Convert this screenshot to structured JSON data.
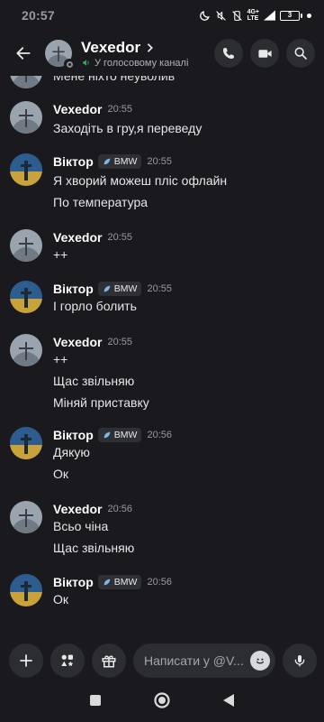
{
  "status": {
    "time": "20:57",
    "network": "4G+",
    "battery": "3"
  },
  "header": {
    "title": "Vexedor",
    "subtitle": "У голосовому каналі"
  },
  "partial_message": "Мене ніхто неуволив",
  "role_tag": "BMW",
  "groups": [
    {
      "author": "Vexedor",
      "tag": false,
      "time": "20:55",
      "lines": [
        "Заходіть в гру,я переведу"
      ]
    },
    {
      "author": "Віктор",
      "tag": true,
      "time": "20:55",
      "lines": [
        "Я хворий можеш пліс офлайн",
        "По температура"
      ]
    },
    {
      "author": "Vexedor",
      "tag": false,
      "time": "20:55",
      "lines": [
        "++"
      ]
    },
    {
      "author": "Віктор",
      "tag": true,
      "time": "20:55",
      "lines": [
        "І горло болить"
      ]
    },
    {
      "author": "Vexedor",
      "tag": false,
      "time": "20:55",
      "lines": [
        "++",
        "Щас звільняю",
        "Міняй приставку"
      ]
    },
    {
      "author": "Віктор",
      "tag": true,
      "time": "20:56",
      "lines": [
        "Дякую",
        "Ок"
      ]
    },
    {
      "author": "Vexedor",
      "tag": false,
      "time": "20:56",
      "lines": [
        "Всьо чіна",
        "Щас звільняю"
      ]
    },
    {
      "author": "Віктор",
      "tag": true,
      "time": "20:56",
      "lines": [
        "Ок"
      ]
    }
  ],
  "composer": {
    "placeholder": "Написати у @V..."
  }
}
